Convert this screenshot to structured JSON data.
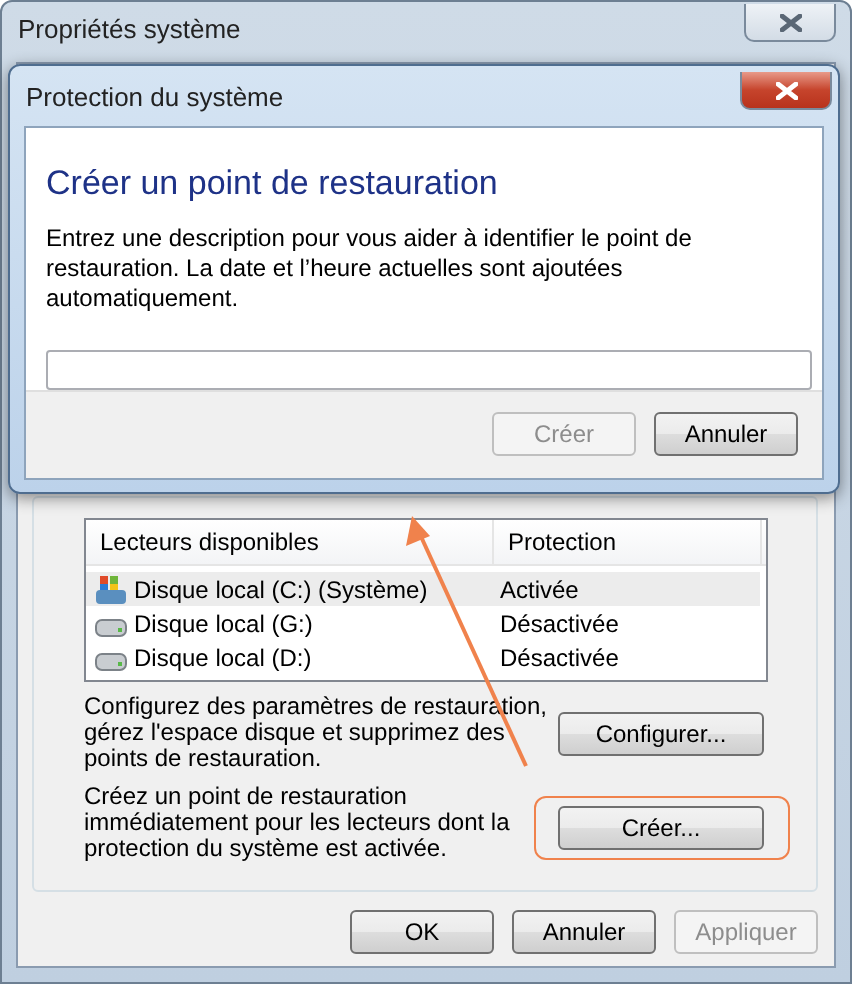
{
  "window": {
    "title": "Propriétés système"
  },
  "drives": {
    "columns": [
      "Lecteurs disponibles",
      "Protection"
    ],
    "rows": [
      {
        "name": "Disque local (C:) (Système)",
        "protection": "Activée",
        "kind": "system",
        "selected": true
      },
      {
        "name": "Disque local (G:)",
        "protection": "Désactivée",
        "kind": "disk",
        "selected": false
      },
      {
        "name": "Disque local (D:)",
        "protection": "Désactivée",
        "kind": "disk",
        "selected": false
      }
    ]
  },
  "configure": {
    "text": "Configurez des paramètres de restauration, gérez l'espace disque et supprimez des points de restauration.",
    "button": "Configurer..."
  },
  "create": {
    "text": "Créez un point de restauration immédiatement pour les lecteurs dont la protection du système est activée.",
    "button": "Créer...",
    "highlighted": true
  },
  "buttons": [
    {
      "label": "OK",
      "disabled": false
    },
    {
      "label": "Annuler",
      "disabled": false
    },
    {
      "label": "Appliquer",
      "disabled": true
    }
  ],
  "dialog": {
    "title": "Protection du système",
    "heading": "Créer un point de restauration",
    "description": "Entrez une description pour vous aider à identifier le point de restauration. La date et l’heure actuelles sont ajoutées automatiquement.",
    "buttons": [
      {
        "label": "Créer",
        "disabled": true
      },
      {
        "label": "Annuler",
        "disabled": false
      }
    ]
  }
}
